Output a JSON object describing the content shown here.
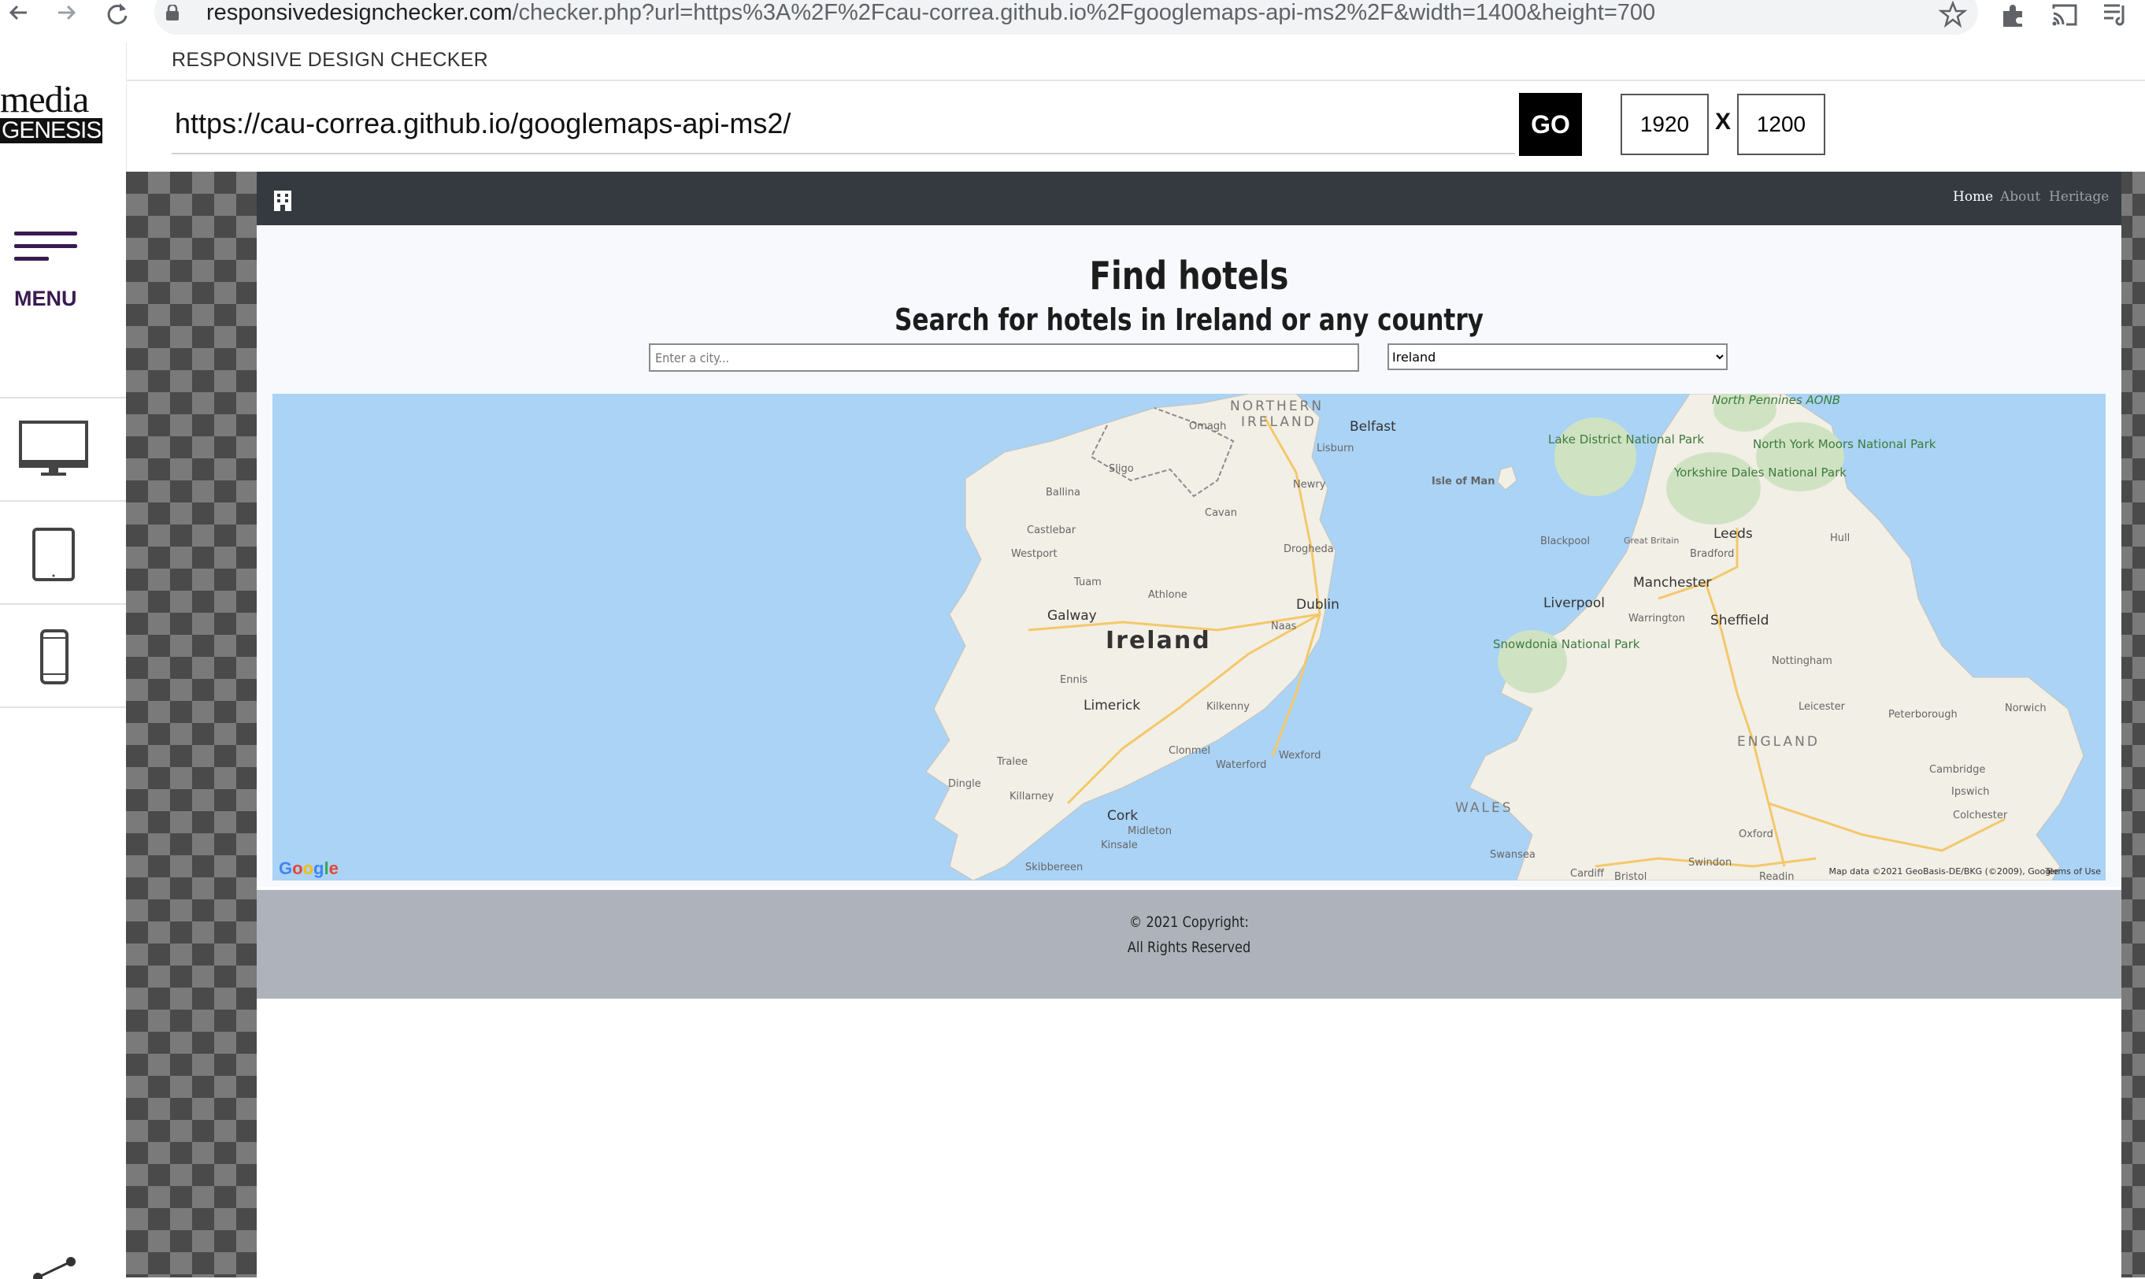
{
  "browser": {
    "url_host": "responsivedesignchecker.com",
    "url_path": "/checker.php?url=https%3A%2F%2Fcau-correa.github.io%2Fgooglemaps-api-ms2%2F&width=1400&height=700"
  },
  "checker": {
    "title": "RESPONSIVE DESIGN CHECKER",
    "logo_top": "media",
    "logo_bottom": "GENESIS",
    "url_value": "https://cau-correa.github.io/googlemaps-api-ms2/",
    "go_label": "GO",
    "width_value": "1920",
    "height_value": "1200",
    "x_label": "X",
    "menu_label": "MENU"
  },
  "site": {
    "nav": {
      "home": "Home",
      "about": "About",
      "heritage": "Heritage"
    },
    "title": "Find hotels",
    "subtitle": "Search for hotels in Ireland or any country",
    "city_placeholder": "Enter a city...",
    "country_selected": "Ireland",
    "footer_line1": "© 2021 Copyright:",
    "footer_line2": "All Rights Reserved"
  },
  "map": {
    "labels": {
      "ireland": "Ireland",
      "northern_ireland_1": "NORTHERN",
      "northern_ireland_2": "IRELAND",
      "england": "ENGLAND",
      "wales": "WALES",
      "isle_of_man": "Isle of Man",
      "belfast": "Belfast",
      "dublin": "Dublin",
      "galway": "Galway",
      "limerick": "Limerick",
      "cork": "Cork",
      "waterford": "Waterford",
      "kilkenny": "Kilkenny",
      "drogheda": "Drogheda",
      "sligo": "Sligo",
      "newry": "Newry",
      "lisburn": "Lisburn",
      "omagh": "Omagh",
      "cavan": "Cavan",
      "athlone": "Athlone",
      "tuam": "Tuam",
      "castlebar": "Castlebar",
      "westport": "Westport",
      "ballina": "Ballina",
      "ennis": "Ennis",
      "tralee": "Tralee",
      "killarney": "Killarney",
      "clonmel": "Clonmel",
      "wexford": "Wexford",
      "naas": "Naas",
      "kinsale": "Kinsale",
      "midleton": "Midleton",
      "skibbereen": "Skibbereen",
      "dingle": "Dingle",
      "liverpool": "Liverpool",
      "manchester": "Manchester",
      "leeds": "Leeds",
      "bradford": "Bradford",
      "sheffield": "Sheffield",
      "hull": "Hull",
      "blackpool": "Blackpool",
      "great_britain": "Great Britain",
      "warrington": "Warrington",
      "nottingham": "Nottingham",
      "leicester": "Leicester",
      "peterborough": "Peterborough",
      "norwich": "Norwich",
      "cambridge": "Cambridge",
      "ipswich": "Ipswich",
      "colchester": "Colchester",
      "oxford": "Oxford",
      "swindon": "Swindon",
      "swansea": "Swansea",
      "cardiff": "Cardiff",
      "bristol": "Bristol",
      "reading": "Readin",
      "lake_district": "Lake District National Park",
      "yorkshire_dales": "Yorkshire Dales National Park",
      "north_york_moors": "North York Moors National Park",
      "snowdonia": "Snowdonia National Park",
      "north_pennines": "North Pennines AONB"
    },
    "google": "Google",
    "attribution": "Map data ©2021 GeoBasis-DE/BKG (©2009), Google",
    "terms": "Terms of Use"
  },
  "colors": {
    "sidebar_accent": "#3a1a52",
    "nav_bg": "#343a40",
    "footer_bg": "#aeb3bb",
    "water": "#aad3f5",
    "land": "#f2efe6"
  }
}
